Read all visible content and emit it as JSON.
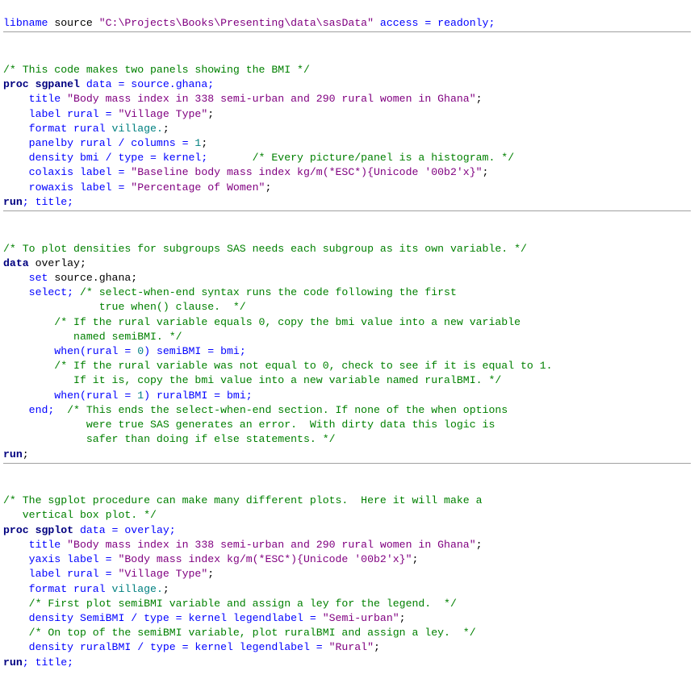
{
  "code": {
    "l1_a": "libname",
    "l1_b": " source ",
    "l1_c": "\"C:\\Projects\\Books\\Presenting\\data\\sasData\"",
    "l1_d": " access = readonly;",
    "l2": " ",
    "l3": "/* This code makes two panels showing the BMI */",
    "l4_a": "proc",
    "l4_b": " ",
    "l4_c": "sgpanel",
    "l4_d": " data = source.ghana;",
    "l5_a": "    title ",
    "l5_b": "\"Body mass index in 338 semi-urban and 290 rural women in Ghana\"",
    "l5_c": ";",
    "l6_a": "    label rural = ",
    "l6_b": "\"Village Type\"",
    "l6_c": ";",
    "l7_a": "    format rural ",
    "l7_b": "village.",
    "l7_c": ";",
    "l8_a": "    panelby rural / columns = ",
    "l8_b": "1",
    "l8_c": ";",
    "l9_a": "    density bmi / type = kernel;       ",
    "l9_b": "/* Every picture/panel is a histogram. */",
    "l10_a": "    colaxis label = ",
    "l10_b": "\"Baseline body mass index kg/m(*ESC*){Unicode '00b2'x}\"",
    "l10_c": ";",
    "l11_a": "    rowaxis label = ",
    "l11_b": "\"Percentage of Women\"",
    "l11_c": ";",
    "l12_a": "run",
    "l12_b": "; title;",
    "l13": " ",
    "l14": "/* To plot densities for subgroups SAS needs each subgroup as its own variable. */",
    "l15_a": "data",
    "l15_b": " overlay;",
    "l16_a": "    set",
    "l16_b": " source.ghana;",
    "l17_a": "    select; ",
    "l17_b": "/* select-when-end syntax runs the code following the first",
    "l18": "               true when() clause.  */",
    "l19": "        /* If the rural variable equals 0, copy the bmi value into a new variable",
    "l20": "           named semiBMI. */",
    "l21_a": "        when(rural = ",
    "l21_b": "0",
    "l21_c": ") semiBMI = bmi;",
    "l22": "        /* If the rural variable was not equal to 0, check to see if it is equal to 1.",
    "l23": "           If it is, copy the bmi value into a new variable named ruralBMI. */",
    "l24_a": "        when(rural = ",
    "l24_b": "1",
    "l24_c": ") ruralBMI = bmi;",
    "l25_a": "    end;  ",
    "l25_b": "/* This ends the select-when-end section. If none of the when options",
    "l26": "             were true SAS generates an error.  With dirty data this logic is",
    "l27": "             safer than doing if else statements. */",
    "l28_a": "run",
    "l28_b": ";",
    "l29": " ",
    "l30": "/* The sgplot procedure can make many different plots.  Here it will make a",
    "l31": "   vertical box plot. */",
    "l32_a": "proc",
    "l32_b": " ",
    "l32_c": "sgplot",
    "l32_d": " data = overlay;",
    "l33_a": "    title ",
    "l33_b": "\"Body mass index in 338 semi-urban and 290 rural women in Ghana\"",
    "l33_c": ";",
    "l34_a": "    yaxis label = ",
    "l34_b": "\"Body mass index kg/m(*ESC*){Unicode '00b2'x}\"",
    "l34_c": ";",
    "l35_a": "    label rural = ",
    "l35_b": "\"Village Type\"",
    "l35_c": ";",
    "l36_a": "    format rural ",
    "l36_b": "village.",
    "l36_c": ";",
    "l37": "    /* First plot semiBMI variable and assign a ley for the legend.  */",
    "l38_a": "    density SemiBMI / type = kernel legendlabel = ",
    "l38_b": "\"Semi-urban\"",
    "l38_c": ";",
    "l39": "    /* On top of the semiBMI variable, plot ruralBMI and assign a ley.  */",
    "l40_a": "    density ruralBMI / type = kernel legendlabel = ",
    "l40_b": "\"Rural\"",
    "l40_c": ";",
    "l41_a": "run",
    "l41_b": "; title;"
  }
}
